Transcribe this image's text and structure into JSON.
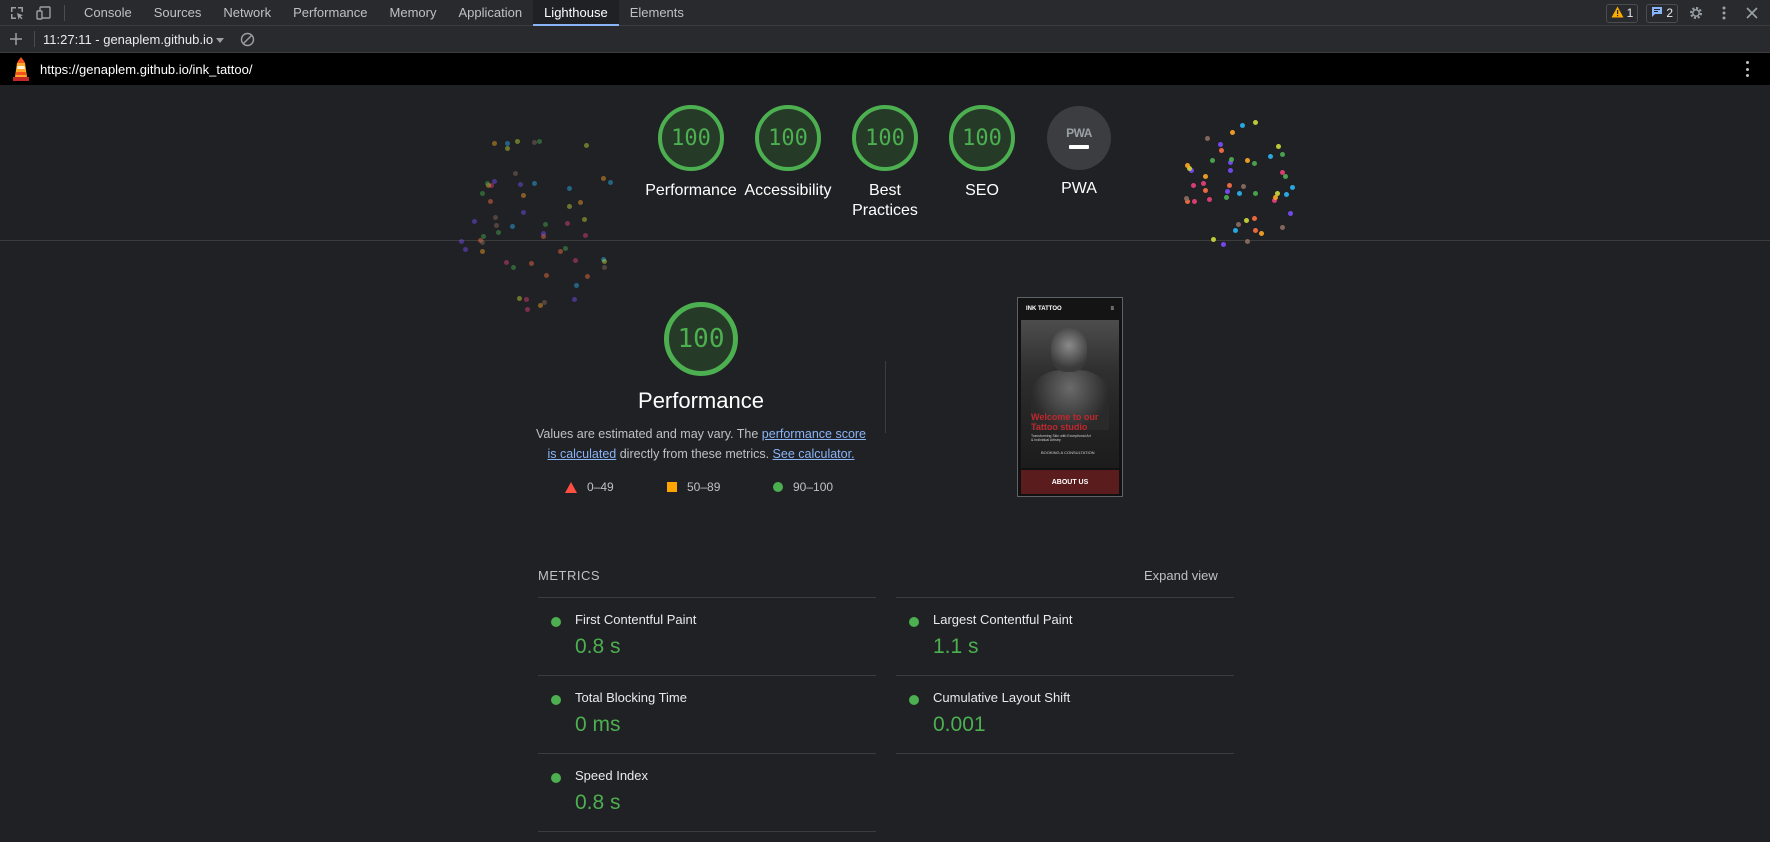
{
  "devtools": {
    "tabs": [
      {
        "label": "Console"
      },
      {
        "label": "Sources"
      },
      {
        "label": "Network"
      },
      {
        "label": "Performance"
      },
      {
        "label": "Memory"
      },
      {
        "label": "Application"
      },
      {
        "label": "Lighthouse",
        "active": true
      },
      {
        "label": "Elements"
      }
    ],
    "warning_count": "1",
    "message_count": "2",
    "icons": [
      "inspect-element-icon",
      "device-toolbar-icon",
      "warning-icon",
      "message-icon",
      "gear-icon",
      "more-vertical-icon",
      "close-icon"
    ]
  },
  "report_bar": {
    "selected_report": "11:27:11 - genaplem.github.io",
    "icons": [
      "plus-icon",
      "dropdown-arrow-icon",
      "clear-icon"
    ]
  },
  "url_bar": {
    "url": "https://genaplem.github.io/ink_tattoo/"
  },
  "header_gauges": [
    {
      "score": "100",
      "label": "Performance"
    },
    {
      "score": "100",
      "label": "Accessibility"
    },
    {
      "score": "100",
      "label": "Best Practices"
    },
    {
      "score": "100",
      "label": "SEO"
    },
    {
      "badge": "PWA",
      "label": "PWA"
    }
  ],
  "performance": {
    "score": "100",
    "title": "Performance",
    "desc_prefix": "Values are estimated and may vary. The ",
    "desc_link1": "performance score is calculated",
    "desc_middle": " directly from these metrics. ",
    "desc_link2": "See calculator.",
    "legend": [
      {
        "range": "0–49",
        "color": "#ff4e42",
        "shape": "triangle"
      },
      {
        "range": "50–89",
        "color": "#ffa400",
        "shape": "square"
      },
      {
        "range": "90–100",
        "color": "#4caf50",
        "shape": "circle"
      }
    ]
  },
  "screenshot": {
    "brand": "INK TATTOO",
    "menu_icon": "≡",
    "headline": "Welcome to our Tattoo studio",
    "subtext": "Transforming Skin with Exceptional Art & Individual Artistry",
    "cta": "BOOKING A CONSULTATION",
    "footer": "ABOUT US"
  },
  "metrics": {
    "title": "METRICS",
    "expand_label": "Expand view",
    "items": [
      {
        "name": "First Contentful Paint",
        "value": "0.8 s"
      },
      {
        "name": "Largest Contentful Paint",
        "value": "1.1 s"
      },
      {
        "name": "Total Blocking Time",
        "value": "0 ms"
      },
      {
        "name": "Cumulative Layout Shift",
        "value": "0.001"
      },
      {
        "name": "Speed Index",
        "value": "0.8 s"
      }
    ]
  },
  "colors": {
    "pass": "#4caf50",
    "accent_link": "#8ab4f8",
    "background": "#202124"
  }
}
